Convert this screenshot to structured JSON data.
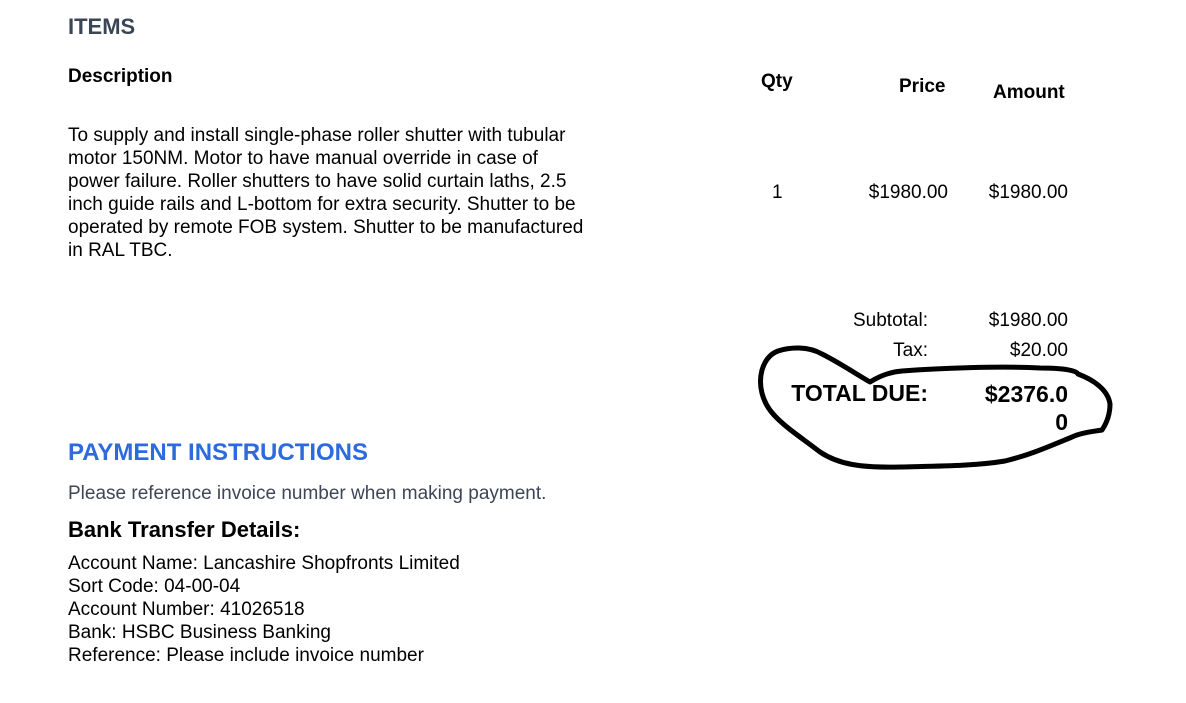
{
  "items": {
    "heading": "ITEMS",
    "columns": {
      "description": "Description",
      "qty": "Qty",
      "price": "Price",
      "amount": "Amount"
    },
    "rows": [
      {
        "description": "To supply and install single-phase roller shutter with tubular motor 150NM. Motor to have manual override in case of power failure. Roller shutters to have solid curtain laths, 2.5 inch guide rails and L-bottom for extra security. Shutter to be operated by remote FOB system. Shutter to be manufactured in RAL TBC.",
        "qty": "1",
        "price": "$1980.00",
        "amount": "$1980.00"
      }
    ]
  },
  "summary": {
    "subtotal_label": "Subtotal:",
    "subtotal_value": "$1980.00",
    "tax_label": "Tax:",
    "tax_value": "$20.00",
    "total_label": "TOTAL DUE:",
    "total_value": "$2376.00"
  },
  "payment": {
    "heading": "PAYMENT INSTRUCTIONS",
    "note": "Please reference invoice number when making payment.",
    "bank_heading": "Bank Transfer Details:",
    "lines": [
      "Account Name: Lancashire Shopfronts Limited",
      "Sort Code: 04-00-04",
      "Account Number: 41026518",
      "Bank: HSBC Business Banking",
      "Reference: Please include invoice number"
    ]
  },
  "colors": {
    "items_heading": "#3a4556",
    "payment_heading": "#2d6ae0",
    "note_text": "#3d4656",
    "annotation_ink": "#000000"
  }
}
